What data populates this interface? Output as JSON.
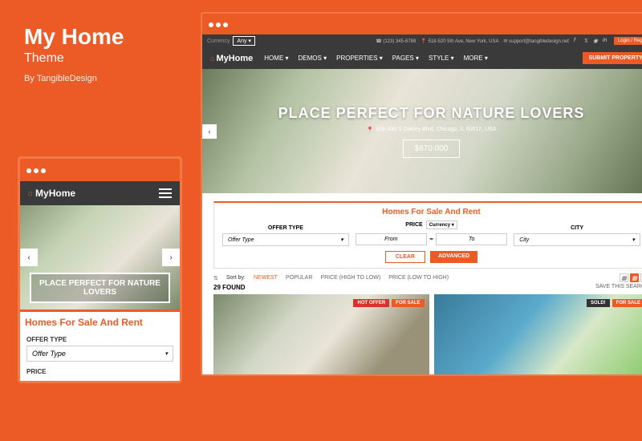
{
  "sidebar": {
    "title": "My Home",
    "subtitle": "Theme",
    "byline": "By TangibleDesign"
  },
  "mobile": {
    "logo": "MyHome",
    "hero_title": "PLACE PERFECT FOR NATURE LOVERS",
    "search_title": "Homes For Sale And Rent",
    "field_offer_label": "OFFER TYPE",
    "field_offer_value": "Offer Type",
    "field_price_label": "PRICE"
  },
  "desktop": {
    "topbar": {
      "currency_label": "Currency",
      "currency_value": "Any ▾",
      "phone": "(123) 345-6789",
      "address": "518-520 5th Ave, New York, USA",
      "email": "support@tangibledesign.net",
      "login": "Login / Register"
    },
    "nav": {
      "logo": "MyHome",
      "items": [
        "HOME ▾",
        "DEMOS ▾",
        "PROPERTIES ▾",
        "PAGES ▾",
        "STYLE ▾",
        "MORE ▾"
      ],
      "submit": "SUBMIT PROPERTY ›"
    },
    "hero": {
      "title": "PLACE PERFECT FOR NATURE LOVERS",
      "address": "318-330 S Oakley Blvd, Chicago, IL 60612, USA",
      "price": "$670.000"
    },
    "search": {
      "title": "Homes For Sale And Rent",
      "offer_label": "OFFER TYPE",
      "offer_value": "Offer Type",
      "price_label": "PRICE",
      "currency_sel": "Currency ▾",
      "from": "From",
      "to": "To",
      "city_label": "CITY",
      "city_value": "City",
      "clear": "CLEAR",
      "advanced": "ADVANCED"
    },
    "sort": {
      "label": "Sort by:",
      "opts": [
        "NEWEST",
        "POPULAR",
        "PRICE (HIGH TO LOW)",
        "PRICE (LOW TO HIGH)"
      ]
    },
    "results": {
      "count": "29 FOUND",
      "save": "SAVE THIS SEARCH"
    },
    "listings": [
      {
        "badges": [
          {
            "cls": "hot",
            "t": "HOT OFFER"
          },
          {
            "cls": "sale",
            "t": "FOR SALE"
          }
        ]
      },
      {
        "badges": [
          {
            "cls": "sold",
            "t": "SOLD!"
          },
          {
            "cls": "sale",
            "t": "FOR SALE"
          }
        ]
      }
    ]
  }
}
